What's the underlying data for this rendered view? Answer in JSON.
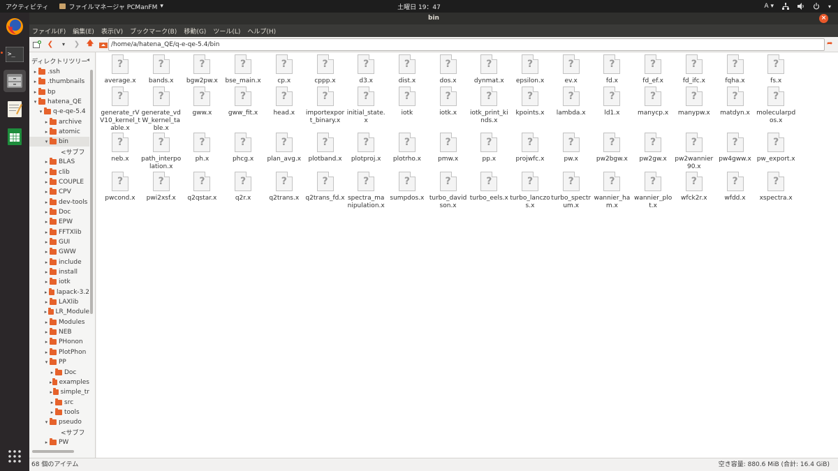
{
  "top_panel": {
    "activities": "アクティビティ",
    "app_menu": "ファイルマネージャ PCManFM",
    "app_menu_arrow": "▾",
    "clock": "土曜日 19：47",
    "input_method": "A",
    "input_arrow": "▾"
  },
  "window": {
    "title": "bin",
    "close_glyph": "×"
  },
  "menubar": [
    "ファイル(F)",
    "編集(E)",
    "表示(V)",
    "ブックマーク(B)",
    "移動(G)",
    "ツール(L)",
    "ヘルプ(H)"
  ],
  "toolbar": {
    "path": "/home/a/hatena_QE/q-e-qe-5.4/bin"
  },
  "sidebar": {
    "header": "ディレクトリツリー",
    "header_arrow": "◂",
    "tree": [
      {
        "label": ".ssh",
        "twisty": "▸",
        "folder": true
      },
      {
        "label": ".thumbnails",
        "twisty": "▸",
        "folder": true
      },
      {
        "label": "bp",
        "twisty": "▸",
        "folder": true
      },
      {
        "label": "hatena_QE",
        "twisty": "▾",
        "folder": true
      },
      {
        "label": "q-e-qe-5.4",
        "twisty": "▾",
        "folder": true
      },
      {
        "label": "archive",
        "twisty": "▸",
        "folder": true
      },
      {
        "label": "atomic",
        "twisty": "▸",
        "folder": true
      },
      {
        "label": "bin",
        "twisty": "▾",
        "folder": true,
        "selected": true
      },
      {
        "label": "<サブフ",
        "twisty": "",
        "folder": false
      },
      {
        "label": "BLAS",
        "twisty": "▸",
        "folder": true
      },
      {
        "label": "clib",
        "twisty": "▸",
        "folder": true
      },
      {
        "label": "COUPLE",
        "twisty": "▸",
        "folder": true
      },
      {
        "label": "CPV",
        "twisty": "▸",
        "folder": true
      },
      {
        "label": "dev-tools",
        "twisty": "▸",
        "folder": true
      },
      {
        "label": "Doc",
        "twisty": "▸",
        "folder": true
      },
      {
        "label": "EPW",
        "twisty": "▸",
        "folder": true
      },
      {
        "label": "FFTXlib",
        "twisty": "▸",
        "folder": true
      },
      {
        "label": "GUI",
        "twisty": "▸",
        "folder": true
      },
      {
        "label": "GWW",
        "twisty": "▸",
        "folder": true
      },
      {
        "label": "include",
        "twisty": "▸",
        "folder": true
      },
      {
        "label": "install",
        "twisty": "▸",
        "folder": true
      },
      {
        "label": "iotk",
        "twisty": "▸",
        "folder": true
      },
      {
        "label": "lapack-3.2",
        "twisty": "▸",
        "folder": true
      },
      {
        "label": "LAXlib",
        "twisty": "▸",
        "folder": true
      },
      {
        "label": "LR_Module",
        "twisty": "▸",
        "folder": true
      },
      {
        "label": "Modules",
        "twisty": "▸",
        "folder": true
      },
      {
        "label": "NEB",
        "twisty": "▸",
        "folder": true
      },
      {
        "label": "PHonon",
        "twisty": "▸",
        "folder": true
      },
      {
        "label": "PlotPhon",
        "twisty": "▸",
        "folder": true
      },
      {
        "label": "PP",
        "twisty": "▾",
        "folder": true
      },
      {
        "label": "Doc",
        "twisty": "▸",
        "folder": true
      },
      {
        "label": "examples",
        "twisty": "▸",
        "folder": true
      },
      {
        "label": "simple_tr",
        "twisty": "▸",
        "folder": true
      },
      {
        "label": "src",
        "twisty": "▸",
        "folder": true
      },
      {
        "label": "tools",
        "twisty": "▸",
        "folder": true
      },
      {
        "label": "pseudo",
        "twisty": "▾",
        "folder": true
      },
      {
        "label": "<サブフ",
        "twisty": "",
        "folder": false
      },
      {
        "label": "PW",
        "twisty": "▸",
        "folder": true
      }
    ]
  },
  "files": [
    "average.x",
    "bands.x",
    "bgw2pw.x",
    "bse_main.x",
    "cp.x",
    "cppp.x",
    "d3.x",
    "dist.x",
    "dos.x",
    "dynmat.x",
    "epsilon.x",
    "ev.x",
    "fd.x",
    "fd_ef.x",
    "fd_ifc.x",
    "fqha.x",
    "fs.x",
    "generate_rVV10_kernel_table.x",
    "generate_vdW_kernel_table.x",
    "gww.x",
    "gww_fit.x",
    "head.x",
    "importexport_binary.x",
    "initial_state.x",
    "iotk",
    "iotk.x",
    "iotk_print_kinds.x",
    "kpoints.x",
    "lambda.x",
    "ld1.x",
    "manycp.x",
    "manypw.x",
    "matdyn.x",
    "molecularpdos.x",
    "neb.x",
    "path_interpolation.x",
    "ph.x",
    "phcg.x",
    "plan_avg.x",
    "plotband.x",
    "plotproj.x",
    "plotrho.x",
    "pmw.x",
    "pp.x",
    "projwfc.x",
    "pw.x",
    "pw2bgw.x",
    "pw2gw.x",
    "pw2wannier90.x",
    "pw4gww.x",
    "pw_export.x",
    "pwcond.x",
    "pwi2xsf.x",
    "q2qstar.x",
    "q2r.x",
    "q2trans.x",
    "q2trans_fd.x",
    "spectra_manipulation.x",
    "sumpdos.x",
    "turbo_davidson.x",
    "turbo_eels.x",
    "turbo_lanczos.x",
    "turbo_spectrum.x",
    "wannier_ham.x",
    "wannier_plot.x",
    "wfck2r.x",
    "wfdd.x",
    "xspectra.x"
  ],
  "file_icon_glyph": "?",
  "status": {
    "count": "68 個のアイテム",
    "free_space": "空き容量: 880.6 MiB (合計: 16.4 GiB)"
  },
  "colors": {
    "accent": "#e95420",
    "folder": "#e6622b",
    "panel": "#1d1d1d",
    "dock": "#2b2729"
  }
}
